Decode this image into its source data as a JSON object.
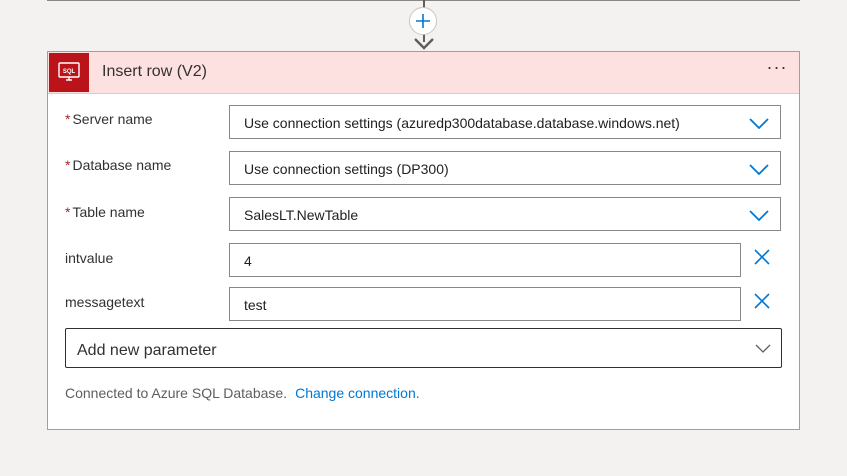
{
  "action": {
    "title": "Insert row (V2)",
    "more_label": "···",
    "required_marker": "*"
  },
  "icons": {
    "step_icon": "sql-database-icon",
    "add_step": "plus-icon",
    "flow_arrow": "arrow-down-icon",
    "dropdown": "chevron-down-icon",
    "clear": "close-icon"
  },
  "colors": {
    "header_bg": "#fde0e0",
    "sql_icon_bg": "#ba141a",
    "accent": "#0078d4",
    "required": "#a4262c"
  },
  "fields": {
    "server": {
      "label": "Server name",
      "value": "Use connection settings (azuredp300database.database.windows.net)"
    },
    "database": {
      "label": "Database name",
      "value": "Use connection settings (DP300)"
    },
    "table": {
      "label": "Table name",
      "value": "SalesLT.NewTable"
    },
    "intvalue": {
      "label": "intvalue",
      "value": "4"
    },
    "messagetext": {
      "label": "messagetext",
      "value": "test"
    }
  },
  "add_parameter": {
    "label": "Add new parameter"
  },
  "footer": {
    "status": "Connected to Azure SQL Database.",
    "change_link": "Change connection."
  }
}
